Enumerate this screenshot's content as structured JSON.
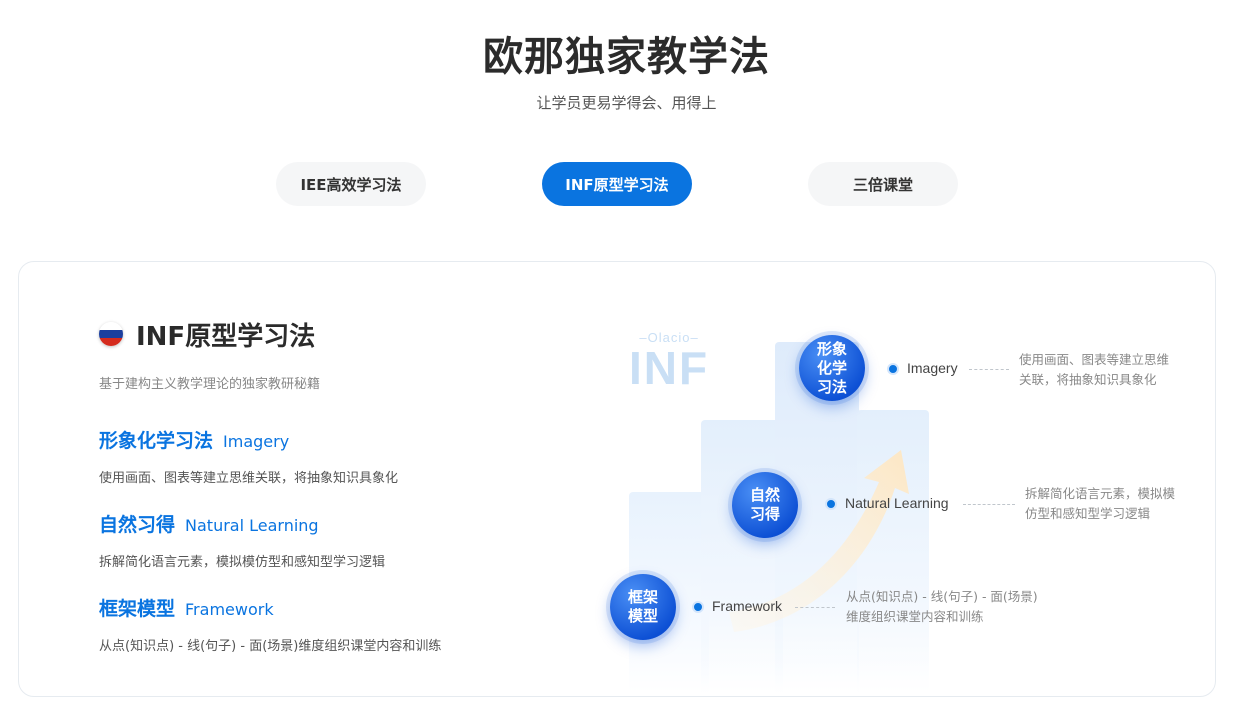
{
  "header": {
    "title": "欧那独家教学法",
    "subtitle": "让学员更易学得会、用得上"
  },
  "tabs": [
    {
      "label": "IEE高效学习法",
      "active": false
    },
    {
      "label": "INF原型学习法",
      "active": true
    },
    {
      "label": "三倍课堂",
      "active": false
    }
  ],
  "card": {
    "flag_icon": "russia-flag-icon",
    "title": "INF原型学习法",
    "subtitle": "基于建构主义教学理论的独家教研秘籍",
    "methods": [
      {
        "zh": "形象化学习法",
        "en": "Imagery",
        "desc": "使用画面、图表等建立思维关联，将抽象知识具象化"
      },
      {
        "zh": "自然习得",
        "en": "Natural Learning",
        "desc": "拆解简化语言元素，模拟模仿型和感知型学习逻辑"
      },
      {
        "zh": "框架模型",
        "en": "Framework",
        "desc": "从点(知识点) - 线(句子) - 面(场景)维度组织课堂内容和训练"
      }
    ]
  },
  "diagram": {
    "logo_small": "Olacio",
    "logo_big": "INF",
    "nodes": [
      {
        "circle": "形象化学习法",
        "label": "Imagery",
        "desc1": "使用画面、图表等建立思维",
        "desc2": "关联，将抽象知识具象化"
      },
      {
        "circle": "自然习得",
        "label": "Natural Learning",
        "desc1": "拆解简化语言元素，模拟模",
        "desc2": "仿型和感知型学习逻辑"
      },
      {
        "circle": "框架模型",
        "label": "Framework",
        "desc1": "从点(知识点) - 线(句子) - 面(场景)",
        "desc2": "维度组织课堂内容和训练"
      }
    ]
  },
  "colors": {
    "accent": "#0a74e0",
    "circle_dark": "#0c4fd4",
    "tab_inactive_bg": "#f5f6f7",
    "flag_white": "#ffffff",
    "flag_blue": "#1c3f9e",
    "flag_red": "#d52b1e"
  }
}
